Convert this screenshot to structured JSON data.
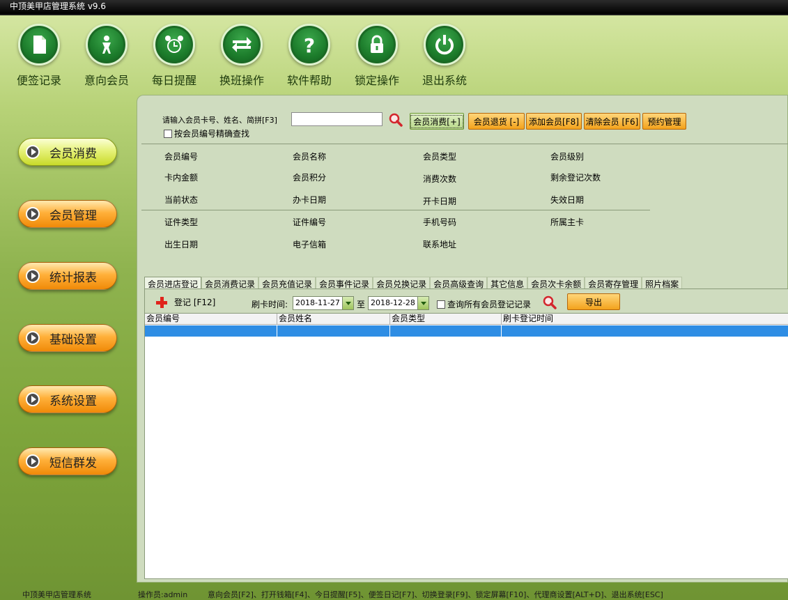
{
  "window": {
    "title": "中顶美甲店管理系统 v9.6"
  },
  "toolbar": {
    "items": [
      {
        "label": "便签记录",
        "icon": "note-icon"
      },
      {
        "label": "意向会员",
        "icon": "person-icon"
      },
      {
        "label": "每日提醒",
        "icon": "alarm-clock-icon"
      },
      {
        "label": "换班操作",
        "icon": "swap-arrows-icon"
      },
      {
        "label": "软件帮助",
        "icon": "help-icon"
      },
      {
        "label": "锁定操作",
        "icon": "lock-icon"
      },
      {
        "label": "退出系统",
        "icon": "power-icon"
      }
    ]
  },
  "sidebar": {
    "items": [
      {
        "label": "会员消费",
        "active": true
      },
      {
        "label": "会员管理"
      },
      {
        "label": "统计报表"
      },
      {
        "label": "基础设置"
      },
      {
        "label": "系统设置"
      },
      {
        "label": "短信群发"
      }
    ]
  },
  "search": {
    "label": "请输入会员卡号、姓名、简拼[F3]",
    "value": "",
    "exact_label": "按会员编号精确查找"
  },
  "actions": {
    "consume": "会员消费[+]",
    "refund": "会员退货 [-]",
    "add": "添加会员[F8]",
    "clear": "清除会员 [F6]",
    "booking": "预约管理"
  },
  "fields": [
    "会员编号",
    "会员名称",
    "会员类型",
    "会员级别",
    "卡内金额",
    "会员积分",
    "消费次数",
    "剩余登记次数",
    "当前状态",
    "办卡日期",
    "开卡日期",
    "失效日期",
    "证件类型",
    "证件编号",
    "手机号码",
    "所属主卡",
    "出生日期",
    "电子信箱",
    "联系地址"
  ],
  "tabs": [
    "会员进店登记",
    "会员消费记录",
    "会员充值记录",
    "会员事件记录",
    "会员兑换记录",
    "会员高级查询",
    "其它信息",
    "会员次卡余额",
    "会员寄存管理",
    "照片档案"
  ],
  "register": {
    "button": "登记 [F12]",
    "time_label": "刷卡时间:",
    "date_from": "2018-11-27",
    "to_label": "至",
    "date_to": "2018-12-28",
    "all_label": "查询所有会员登记记录",
    "export": "导出"
  },
  "table": {
    "columns": [
      "会员编号",
      "会员姓名",
      "会员类型",
      "刷卡登记时间"
    ]
  },
  "status": {
    "app": "中顶美甲店管理系统",
    "operator": "操作员:admin",
    "shortcuts": "意向会员[F2]、打开钱箱[F4]、今日提醒[F5]、便签日记[F7]、切换登录[F9]、锁定屏幕[F10]、代理商设置[ALT+D]、退出系统[ESC]"
  },
  "colors": {
    "accent_green": "#1d7d2c",
    "selection_blue": "#2e8de4",
    "orange": "#f3a21c"
  }
}
